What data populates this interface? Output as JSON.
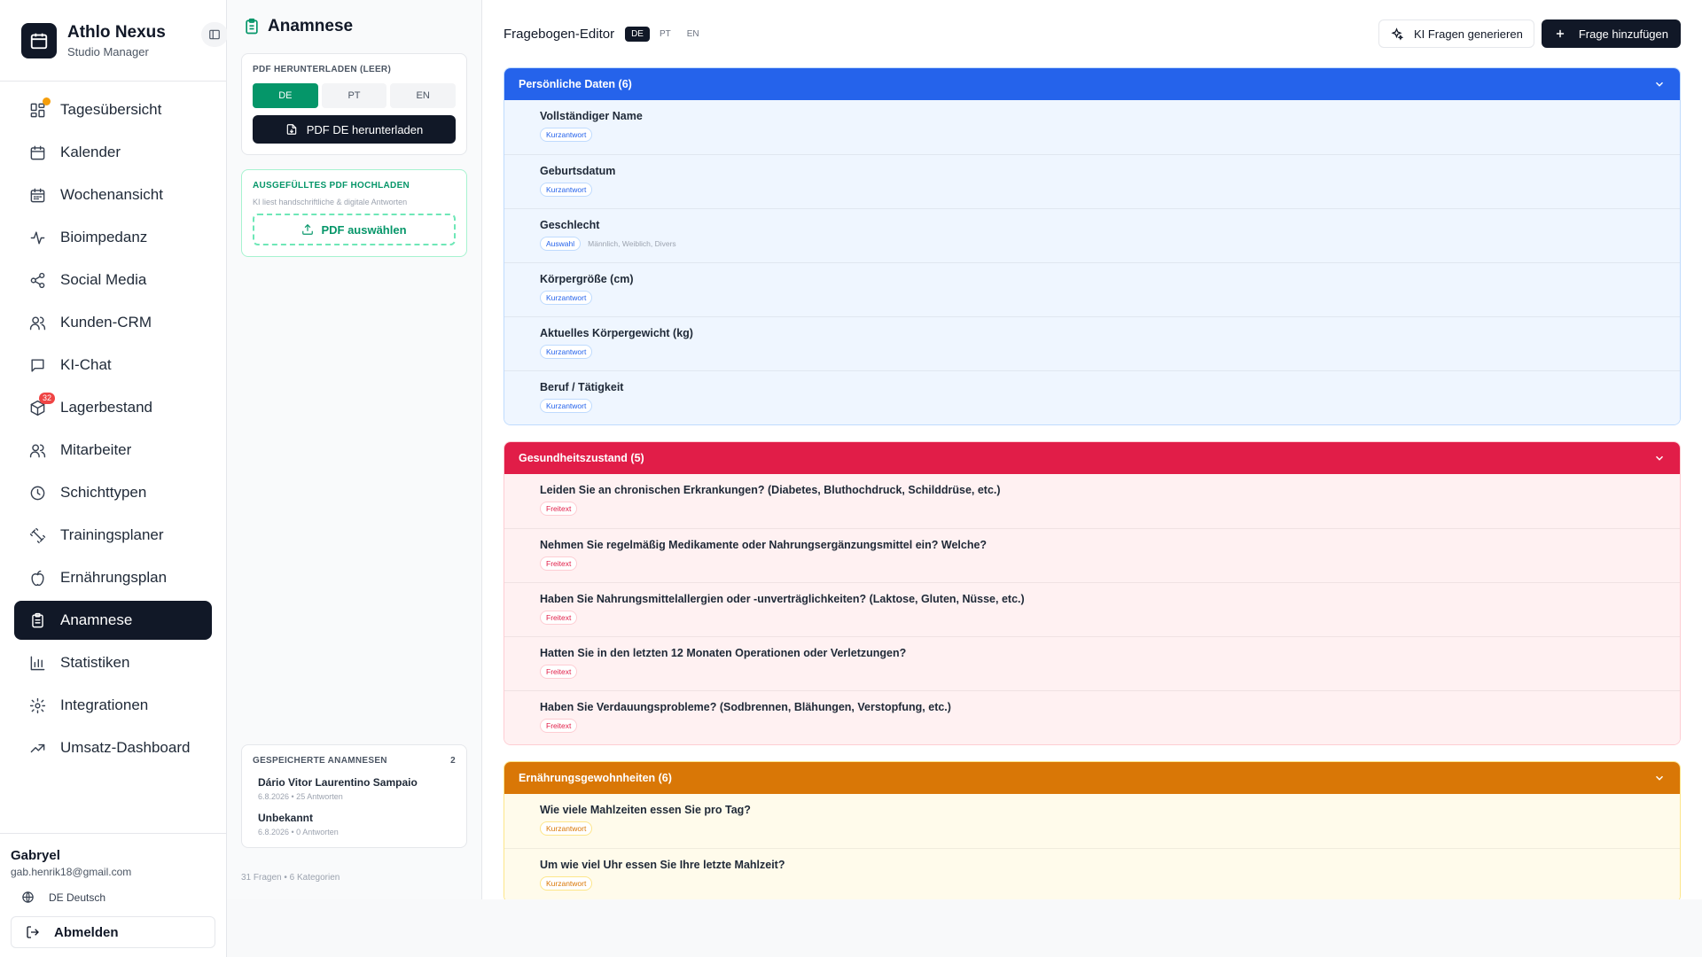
{
  "brand": {
    "title": "Athlo Nexus",
    "subtitle": "Studio Manager"
  },
  "nav": [
    {
      "label": "Tagesübersicht",
      "icon": "dashboard-icon",
      "dot": true
    },
    {
      "label": "Kalender",
      "icon": "calendar-icon"
    },
    {
      "label": "Wochenansicht",
      "icon": "calendar-week-icon"
    },
    {
      "label": "Bioimpedanz",
      "icon": "activity-icon"
    },
    {
      "label": "Social Media",
      "icon": "share-icon"
    },
    {
      "label": "Kunden-CRM",
      "icon": "users-icon"
    },
    {
      "label": "KI-Chat",
      "icon": "chat-icon"
    },
    {
      "label": "Lagerbestand",
      "icon": "package-icon",
      "badge": "32"
    },
    {
      "label": "Mitarbeiter",
      "icon": "staff-icon"
    },
    {
      "label": "Schichttypen",
      "icon": "clock-icon"
    },
    {
      "label": "Trainingsplaner",
      "icon": "dumbbell-icon"
    },
    {
      "label": "Ernährungsplan",
      "icon": "apple-icon"
    },
    {
      "label": "Anamnese",
      "icon": "clipboard-icon",
      "active": true
    },
    {
      "label": "Statistiken",
      "icon": "bar-chart-icon"
    },
    {
      "label": "Integrationen",
      "icon": "settings-icon"
    },
    {
      "label": "Umsatz-Dashboard",
      "icon": "trending-up-icon"
    }
  ],
  "user": {
    "name": "Gabryel",
    "email": "gab.henrik18@gmail.com",
    "language": "DE Deutsch",
    "logout": "Abmelden"
  },
  "mid": {
    "title": "Anamnese",
    "download": {
      "label": "PDF herunterladen (leer)",
      "langs": [
        "DE",
        "PT",
        "EN"
      ],
      "active_lang": "DE",
      "button": "PDF DE herunterladen"
    },
    "upload": {
      "label": "Ausgefülltes PDF hochladen",
      "hint": "KI liest handschriftliche & digitale Antworten",
      "button": "PDF auswählen"
    },
    "saved": {
      "label": "Gespeicherte Anamnesen",
      "count": "2",
      "items": [
        {
          "name": "Dário Vitor Laurentino Sampaio",
          "meta": "6.8.2026 • 25 Antworten"
        },
        {
          "name": "Unbekannt",
          "meta": "6.8.2026 • 0 Antworten"
        }
      ]
    },
    "footer": "31 Fragen • 6 Kategorien"
  },
  "editor": {
    "title": "Fragebogen-Editor",
    "langs": [
      "DE",
      "PT",
      "EN"
    ],
    "active_lang": "DE",
    "ai_button": "KI Fragen generieren",
    "add_button": "Frage hinzufügen"
  },
  "sections": [
    {
      "title": "Persönliche Daten (6)",
      "color": "#2563eb",
      "questions": [
        {
          "text": "Vollständiger Name",
          "type": "Kurzantwort"
        },
        {
          "text": "Geburtsdatum",
          "type": "Kurzantwort"
        },
        {
          "text": "Geschlecht",
          "type": "Auswahl",
          "options": "Männlich, Weiblich, Divers"
        },
        {
          "text": "Körpergröße (cm)",
          "type": "Kurzantwort"
        },
        {
          "text": "Aktuelles Körpergewicht (kg)",
          "type": "Kurzantwort"
        },
        {
          "text": "Beruf / Tätigkeit",
          "type": "Kurzantwort"
        }
      ]
    },
    {
      "title": "Gesundheitszustand (5)",
      "color": "#e11d48",
      "questions": [
        {
          "text": "Leiden Sie an chronischen Erkrankungen? (Diabetes, Bluthochdruck, Schilddrüse, etc.)",
          "type": "Freitext"
        },
        {
          "text": "Nehmen Sie regelmäßig Medikamente oder Nahrungsergänzungsmittel ein? Welche?",
          "type": "Freitext"
        },
        {
          "text": "Haben Sie Nahrungsmittelallergien oder -unverträglichkeiten? (Laktose, Gluten, Nüsse, etc.)",
          "type": "Freitext"
        },
        {
          "text": "Hatten Sie in den letzten 12 Monaten Operationen oder Verletzungen?",
          "type": "Freitext"
        },
        {
          "text": "Haben Sie Verdauungsprobleme? (Sodbrennen, Blähungen, Verstopfung, etc.)",
          "type": "Freitext"
        }
      ]
    },
    {
      "title": "Ernährungsgewohnheiten (6)",
      "color": "#d97706",
      "questions": [
        {
          "text": "Wie viele Mahlzeiten essen Sie pro Tag?",
          "type": "Kurzantwort"
        },
        {
          "text": "Um wie viel Uhr essen Sie Ihre letzte Mahlzeit?",
          "type": "Kurzantwort"
        }
      ]
    }
  ]
}
